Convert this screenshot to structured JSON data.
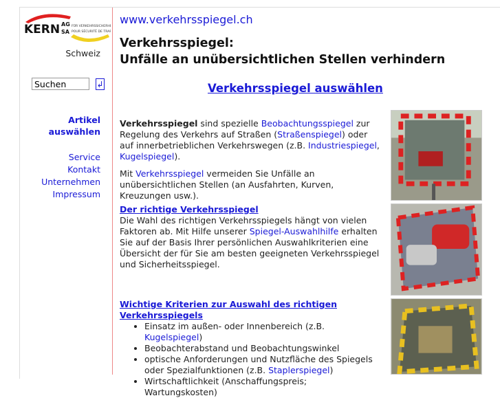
{
  "logo": {
    "text": "KERN AG SA",
    "tag1": "FÜR VERKEHRSSICHERHEIT",
    "tag2": "POUR SÉCURITÉ DE TRAFIC"
  },
  "sidebar": {
    "country": "Schweiz",
    "search_placeholder": "Suchen",
    "search_value": "Suchen",
    "go_icon": "enter-icon",
    "nav_main": [
      "Artikel",
      "auswählen"
    ],
    "nav": [
      "Service",
      "Kontakt",
      "Unternehmen",
      "Impressum"
    ]
  },
  "main": {
    "url": "www.verkehrsspiegel.ch",
    "title1": "Verkehrsspiegel:",
    "title2": "Unfälle an unübersichtlichen Stellen verhindern",
    "select_link": "Verkehrsspiegel auswählen",
    "p1": {
      "b": "Verkehrsspiegel",
      "t1": " sind spezielle ",
      "l1": "Beobachtungsspiegel",
      "t2": " zur Regelung des Verkehrs auf Straßen (",
      "l2": "Straßenspiegel",
      "t3": ") oder auf innerbetrieblichen Verkehrswegen (z.B. ",
      "l3": "Industriespiegel",
      "t4": ", ",
      "l4": "Kugelspiegel",
      "t5": ")."
    },
    "p2": {
      "t1": "Mit ",
      "l1": "Verkehrsspiegel",
      "t2": " vermeiden Sie Unfälle an unübersichtlichen Stellen (an Ausfahrten, Kurven, Kreuzungen usw.)."
    },
    "s2": {
      "heading": "Der richtige Verkehrsspiegel",
      "t1": "Die Wahl des richtigen Verkehrsspiegels hängt von vielen Faktoren ab. Mit Hilfe unserer ",
      "l1": "Spiegel-Auswahlhilfe",
      "t2": " erhalten Sie auf der Basis Ihrer persönlichen Auswahlkriterien eine Übersicht der für Sie am besten geeigneten Verkehrsspiegel und Sicherheitsspiegel."
    },
    "s3": {
      "heading": "Wichtige Kriterien zur Auswahl des richtigen Verkehrsspiegels",
      "i1": {
        "t": "Einsatz im außen- oder Innenbereich (z.B. ",
        "l": "Kugelspiegel",
        "e": ")"
      },
      "i2": "Beobachterabstand und Beobachtungswinkel",
      "i3": {
        "t": "optische Anforderungen und Nutzfläche des Spiegels oder Spezialfunktionen (z.B. ",
        "l": "Staplerspiegel",
        "e": ")"
      },
      "i4": "Wirtschaftlichkeit (Anschaffungspreis; Wartungskosten)"
    }
  }
}
